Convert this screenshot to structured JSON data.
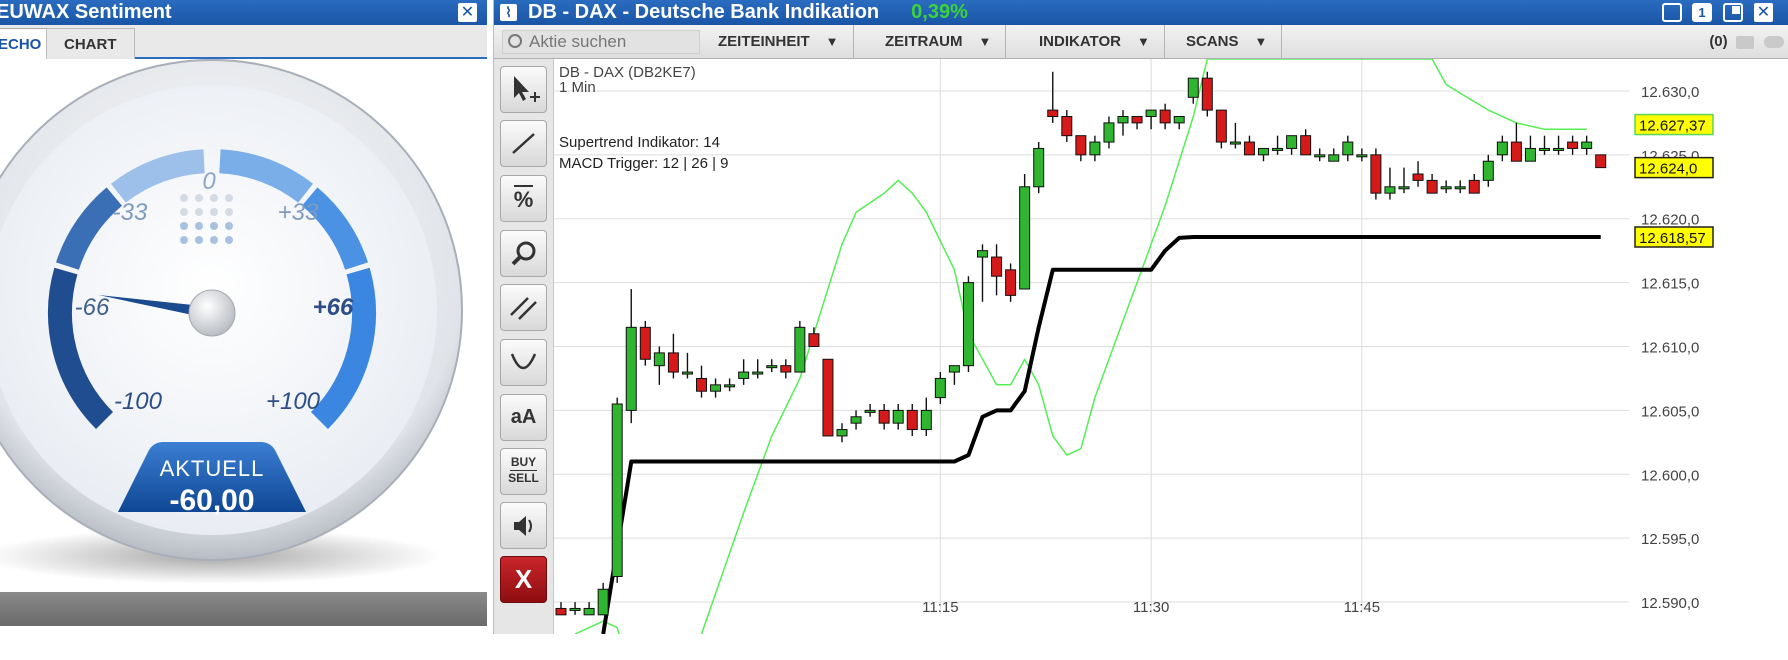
{
  "left_panel": {
    "title": "EUWAX Sentiment",
    "tabs": [
      {
        "label": "ECHO",
        "active": true
      },
      {
        "label": "CHART",
        "active": false
      }
    ],
    "gauge": {
      "scale_labels": [
        "-100",
        "-66",
        "-33",
        "0",
        "+33",
        "+66",
        "+100"
      ],
      "current_label": "AKTUELL",
      "current_value": "-60,00",
      "value_numeric": -60
    }
  },
  "right_panel": {
    "title": "DB - DAX - Deutsche Bank Indikation",
    "change": "0,39%",
    "toolbar": {
      "search_placeholder": "Aktie suchen",
      "menus": [
        "ZEITEINHEIT",
        "ZEITRAUM",
        "INDIKATOR",
        "SCANS"
      ],
      "count": "(0)"
    },
    "chart_info": {
      "instrument": "DB - DAX (DB2KE7)",
      "interval": "1 Min",
      "indicator1": "Supertrend Indikator: 14",
      "indicator2": "MACD Trigger: 12 | 26 | 9"
    },
    "tools": [
      "arrow-tool",
      "line-tool",
      "percent-tool",
      "zoom-tool",
      "parallel-tool",
      "curve-tool",
      "text-tool",
      "buy-sell-tool",
      "sound-tool",
      "close-tool"
    ],
    "tool_text": {
      "percent": "%",
      "text": "aA",
      "buy": "BUY",
      "sell": "SELL",
      "close": "X"
    }
  },
  "colors": {
    "titlebar": "#1a55a6",
    "up": "#2fb52f",
    "down": "#d61a1a",
    "supertrend": "#000000",
    "macd": "#55ee55",
    "price_box": "#ffff00"
  },
  "chart_data": {
    "type": "candlestick",
    "ylim": [
      12587.5,
      12632.5
    ],
    "y_ticks": [
      "12.590,0",
      "12.595,0",
      "12.600,0",
      "12.605,0",
      "12.610,0",
      "12.615,0",
      "12.620,0",
      "12.625,0",
      "12.630,0"
    ],
    "y_tick_values": [
      12590,
      12595,
      12600,
      12605,
      12610,
      12615,
      12620,
      12625,
      12630
    ],
    "x_ticks": [
      "11:15",
      "11:30",
      "11:45"
    ],
    "x_tick_index": [
      27,
      42,
      57
    ],
    "price_labels": [
      {
        "text": "12.627,37",
        "value": 12627.37,
        "style": "green-border"
      },
      {
        "text": "12.624,0",
        "value": 12624.0,
        "style": "black-border"
      },
      {
        "text": "12.618,57",
        "value": 12618.57,
        "style": "black-border"
      }
    ],
    "candles": [
      [
        12589.5,
        12590.0,
        12589.0,
        12589.0
      ],
      [
        12589.5,
        12590.0,
        12589.0,
        12589.5
      ],
      [
        12589.0,
        12590.0,
        12589.0,
        12589.5
      ],
      [
        12589.0,
        12591.5,
        12589.0,
        12591.0
      ],
      [
        12592.0,
        12606.0,
        12591.5,
        12605.5
      ],
      [
        12605.0,
        12614.5,
        12604.0,
        12611.5
      ],
      [
        12611.5,
        12612.0,
        12608.5,
        12609.0
      ],
      [
        12608.5,
        12610.0,
        12607.0,
        12609.5
      ],
      [
        12609.5,
        12611.0,
        12607.5,
        12608.0
      ],
      [
        12608.0,
        12609.5,
        12607.5,
        12608.0
      ],
      [
        12607.5,
        12608.5,
        12606.0,
        12606.5
      ],
      [
        12606.5,
        12607.5,
        12606.0,
        12607.0
      ],
      [
        12607.0,
        12607.5,
        12606.5,
        12607.0
      ],
      [
        12607.5,
        12609.0,
        12607.0,
        12608.0
      ],
      [
        12608.0,
        12609.0,
        12607.5,
        12608.0
      ],
      [
        12608.5,
        12609.0,
        12608.0,
        12608.5
      ],
      [
        12608.5,
        12609.0,
        12607.5,
        12608.0
      ],
      [
        12608.0,
        12612.0,
        12608.0,
        12611.5
      ],
      [
        12611.0,
        12611.5,
        12610.0,
        12610.0
      ],
      [
        12609.0,
        12609.0,
        12603.0,
        12603.0
      ],
      [
        12603.0,
        12604.0,
        12602.5,
        12603.5
      ],
      [
        12604.0,
        12605.0,
        12603.5,
        12604.5
      ],
      [
        12605.0,
        12605.5,
        12604.5,
        12605.0
      ],
      [
        12605.0,
        12605.5,
        12603.5,
        12604.0
      ],
      [
        12604.0,
        12605.5,
        12603.5,
        12605.0
      ],
      [
        12605.0,
        12605.5,
        12603.0,
        12603.5
      ],
      [
        12603.5,
        12606.0,
        12603.0,
        12605.0
      ],
      [
        12606.0,
        12608.0,
        12605.5,
        12607.5
      ],
      [
        12608.0,
        12608.5,
        12607.0,
        12608.5
      ],
      [
        12608.5,
        12615.5,
        12608.0,
        12615.0
      ],
      [
        12617.0,
        12618.0,
        12613.5,
        12617.5
      ],
      [
        12617.0,
        12618.0,
        12614.0,
        12615.5
      ],
      [
        12616.0,
        12616.5,
        12613.5,
        12614.0
      ],
      [
        12614.5,
        12623.5,
        12614.5,
        12622.5
      ],
      [
        12622.5,
        12626.0,
        12622.0,
        12625.5
      ],
      [
        12628.5,
        12631.5,
        12627.5,
        12628.0
      ],
      [
        12628.0,
        12628.5,
        12626.0,
        12626.5
      ],
      [
        12626.5,
        12626.5,
        12624.5,
        12625.0
      ],
      [
        12625.0,
        12626.5,
        12624.5,
        12626.0
      ],
      [
        12626.0,
        12628.0,
        12625.5,
        12627.5
      ],
      [
        12627.5,
        12628.5,
        12626.5,
        12628.0
      ],
      [
        12628.0,
        12628.0,
        12627.0,
        12627.5
      ],
      [
        12628.0,
        12628.5,
        12627.0,
        12628.5
      ],
      [
        12628.5,
        12629.0,
        12627.0,
        12627.5
      ],
      [
        12627.5,
        12628.0,
        12627.0,
        12628.0
      ],
      [
        12629.5,
        12631.0,
        12629.0,
        12631.0
      ],
      [
        12631.0,
        12631.5,
        12628.0,
        12628.5
      ],
      [
        12628.5,
        12628.5,
        12625.5,
        12626.0
      ],
      [
        12626.0,
        12627.5,
        12625.5,
        12626.0
      ],
      [
        12626.0,
        12626.5,
        12625.0,
        12625.0
      ],
      [
        12625.0,
        12625.5,
        12624.5,
        12625.5
      ],
      [
        12625.5,
        12626.5,
        12625.0,
        12625.5
      ],
      [
        12625.5,
        12626.5,
        12625.0,
        12626.5
      ],
      [
        12626.5,
        12627.0,
        12625.0,
        12625.0
      ],
      [
        12625.0,
        12625.5,
        12624.5,
        12625.0
      ],
      [
        12624.5,
        12625.5,
        12624.5,
        12625.0
      ],
      [
        12625.0,
        12626.5,
        12624.5,
        12626.0
      ],
      [
        12625.0,
        12625.5,
        12624.5,
        12625.0
      ],
      [
        12625.0,
        12625.5,
        12621.5,
        12622.0
      ],
      [
        12622.0,
        12624.0,
        12621.5,
        12622.5
      ],
      [
        12622.5,
        12624.0,
        12622.0,
        12622.5
      ],
      [
        12623.5,
        12624.5,
        12622.5,
        12623.0
      ],
      [
        12623.0,
        12623.5,
        12622.0,
        12622.0
      ],
      [
        12622.5,
        12623.0,
        12622.0,
        12622.5
      ],
      [
        12622.5,
        12623.0,
        12622.0,
        12622.5
      ],
      [
        12623.0,
        12623.5,
        12622.0,
        12622.0
      ],
      [
        12623.0,
        12625.0,
        12622.5,
        12624.5
      ],
      [
        12625.0,
        12626.5,
        12624.5,
        12626.0
      ],
      [
        12626.0,
        12627.5,
        12624.5,
        12624.5
      ],
      [
        12624.5,
        12626.5,
        12624.5,
        12625.5
      ],
      [
        12625.5,
        12626.5,
        12625.0,
        12625.5
      ],
      [
        12625.5,
        12626.5,
        12625.0,
        12625.5
      ],
      [
        12626.0,
        12626.5,
        12625.0,
        12625.5
      ],
      [
        12625.5,
        12626.5,
        12625.0,
        12626.0
      ],
      [
        12625.0,
        12625.0,
        12624.0,
        12624.0
      ]
    ],
    "supertrend": [
      [
        3,
        12587.5
      ],
      [
        5,
        12601.0
      ],
      [
        28,
        12601.0
      ],
      [
        29,
        12601.5
      ],
      [
        30,
        12604.5
      ],
      [
        31,
        12605.0
      ],
      [
        32,
        12605.0
      ],
      [
        33,
        12606.5
      ],
      [
        34,
        12611.5
      ],
      [
        35,
        12616.0
      ],
      [
        41,
        12616.0
      ],
      [
        42,
        12616.0
      ],
      [
        43,
        12617.5
      ],
      [
        44,
        12618.5
      ],
      [
        45,
        12618.57
      ],
      [
        74,
        12618.57
      ]
    ],
    "macd_trigger": [
      [
        1,
        12587.5
      ],
      [
        3,
        12588.5
      ],
      [
        4,
        12588.0
      ],
      [
        5,
        12584.0
      ],
      [
        10,
        12587.5
      ],
      [
        13,
        12597.0
      ],
      [
        15,
        12603.0
      ],
      [
        17,
        12607.5
      ],
      [
        18,
        12611.0
      ],
      [
        19,
        12614.5
      ],
      [
        20,
        12618.0
      ],
      [
        21,
        12620.5
      ],
      [
        23,
        12622.0
      ],
      [
        24,
        12623.0
      ],
      [
        25,
        12622.0
      ],
      [
        26,
        12620.5
      ],
      [
        28,
        12616.0
      ],
      [
        29,
        12611.0
      ],
      [
        31,
        12607.0
      ],
      [
        32,
        12607.0
      ],
      [
        33,
        12609.0
      ],
      [
        34,
        12607.0
      ],
      [
        35,
        12603.0
      ],
      [
        36,
        12601.5
      ],
      [
        37,
        12602.0
      ],
      [
        38,
        12606.0
      ],
      [
        40,
        12612.0
      ],
      [
        42,
        12618.0
      ],
      [
        43,
        12621.0
      ],
      [
        45,
        12628.0
      ],
      [
        46,
        12632.5
      ],
      [
        60,
        12632.5
      ],
      [
        62,
        12632.5
      ],
      [
        63,
        12630.5
      ],
      [
        66,
        12628.5
      ],
      [
        68,
        12627.5
      ],
      [
        70,
        12627.0
      ],
      [
        73,
        12627.0
      ]
    ]
  }
}
